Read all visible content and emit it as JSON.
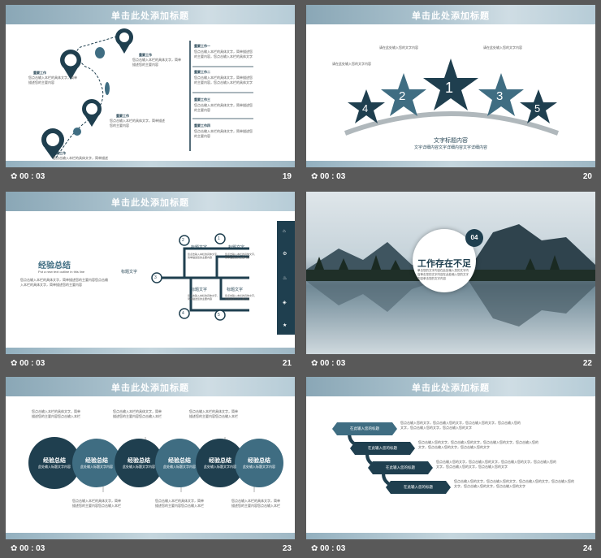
{
  "title": "单击此处添加标题",
  "slides": [
    {
      "number": "19",
      "time": "00 : 03",
      "left_items": [
        {
          "title": "重要工作",
          "text": "您点击输入本栏的具体文字，简单描述您的主要内容"
        },
        {
          "title": "重要工作",
          "text": "您点击输入本栏的具体文字，简单描述您的主要内容"
        },
        {
          "title": "重要工作",
          "text": "您点击输入本栏的具体文字，简单描述您的主要内容"
        },
        {
          "title": "重要工作",
          "text": "您点击输入本栏的具体文字，简单描述您的主要内容"
        }
      ],
      "right_items": [
        {
          "title": "重要工作一",
          "text": "您点击输入本栏的具体文字，简单描述您的主要内容，您点击输入本栏的具体文字"
        },
        {
          "title": "重要工作二",
          "text": "您点击输入本栏的具体文字，简单描述您的主要内容，您点击输入本栏的具体文字"
        },
        {
          "title": "重要工作三",
          "text": "您点击输入本栏的具体文字，简单描述您的主要内容"
        },
        {
          "title": "重要工作四",
          "text": "您点击输入本栏的具体文字，简单描述您的主要内容"
        }
      ]
    },
    {
      "number": "20",
      "time": "00 : 03",
      "stars": [
        "1",
        "2",
        "3",
        "4",
        "5"
      ],
      "labels": [
        "请在此处输入您的文字内容",
        "请在此处输入您的文字内容",
        "请在此处输入您的文字内容"
      ],
      "caption_title": "文字标题内容",
      "caption_text": "文字详细内容文字详细内容文字详细内容"
    },
    {
      "number": "21",
      "time": "00 : 03",
      "heading": "经验总结",
      "subheading": "Put a new text outline in this line",
      "body": "您点击输入本栏的具体文字，简单描述您的主要内容您点击输入本栏的具体文字，简单描述您的主要内容",
      "nodes": [
        {
          "num": "1",
          "label": "标题文字"
        },
        {
          "num": "2",
          "label": "标题文字"
        },
        {
          "num": "3",
          "label": "标题文字"
        },
        {
          "num": "4",
          "label": "标题文字"
        },
        {
          "num": "5",
          "label": "标题文字"
        }
      ],
      "node_text": "您点击输入本栏的具体文字，简单描述您的主要内容"
    },
    {
      "number": "22",
      "time": "00 : 03",
      "badge": "04",
      "title": "工作存在不足",
      "text": "单击您的文字内容在此处输入您的文字内容单击您的文字内容在此处输入您的文字内容单击您的文字内容"
    },
    {
      "number": "23",
      "time": "00 : 03",
      "circle_title": "经验总结",
      "circle_text": "此处输入标题文字内容",
      "note": "您点击输入本栏的具体文字，简单描述您的主要内容您点击输入本栏"
    },
    {
      "number": "24",
      "time": "00 : 03",
      "tags": [
        "在此输入您的标题",
        "在此输入您的标题",
        "在此输入您的标题",
        "在此输入您的标题"
      ],
      "para": "您点击输入您的文字，您点击输入您的文字，您点击输入您的文字，您点击输入您的文字，您点击输入您的文字，您点击输入您的文字"
    }
  ],
  "colors": {
    "primary": "#1f3f4f",
    "secondary": "#3f6d82",
    "accent": "#8ba9b8"
  }
}
